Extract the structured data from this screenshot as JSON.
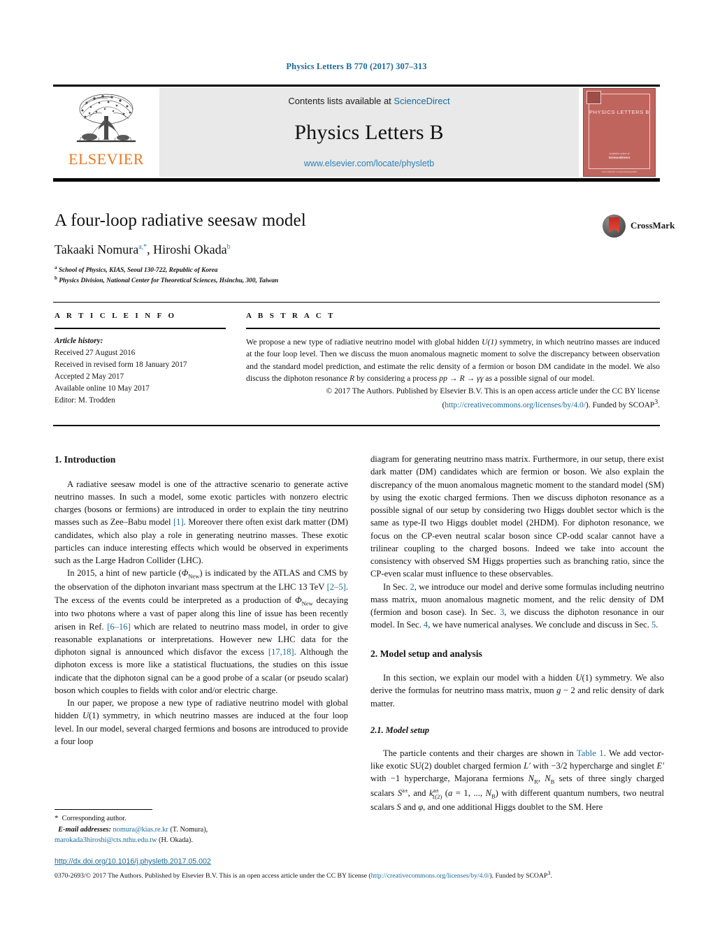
{
  "running_head": "Physics Letters B 770 (2017) 307–313",
  "masthead": {
    "contents_prefix": "Contents lists available at ",
    "contents_link": "ScienceDirect",
    "journal": "Physics Letters B",
    "url": "www.elsevier.com/locate/physletb",
    "publisher": "ELSEVIER",
    "cover": {
      "title": "PHYSICS LETTERS B",
      "foot1": "Available online at",
      "foot2": "ScienceDirect",
      "foot3": "www.elsevier.com/locate/physletb"
    }
  },
  "article": {
    "title": "A four-loop radiative seesaw model",
    "authors_part1": "Takaaki Nomura",
    "authors_sup1": "a,*",
    "authors_part2": ", Hiroshi Okada",
    "authors_sup2": "b",
    "affiliation_a": "School of Physics, KIAS, Seoul 130-722, Republic of Korea",
    "affiliation_b": "Physics Division, National Center for Theoretical Sciences, Hsinchu, 300, Taiwan",
    "crossmark_label": "CrossMark"
  },
  "info": {
    "heading": "A R T I C L E  I N F O",
    "history_label": "Article history:",
    "lines": [
      "Received 27 August 2016",
      "Received in revised form 18 January 2017",
      "Accepted 2 May 2017",
      "Available online 10 May 2017",
      "Editor: M. Trodden"
    ]
  },
  "abstract": {
    "heading": "A B S T R A C T",
    "body_1": "We propose a new type of radiative neutrino model with global hidden ",
    "body_u1": "U(1)",
    "body_2": " symmetry, in which neutrino masses are induced at the four loop level. Then we discuss the muon anomalous magnetic moment to solve the discrepancy between observation and the standard model prediction, and estimate the relic density of a fermion or boson DM candidate in the model. We also discuss the diphoton resonance ",
    "body_R": "R",
    "body_3": " by considering a process ",
    "body_proc": "pp → R → γγ",
    "body_4": " as a possible signal of our model.",
    "copyright_1": "© 2017 The Authors. Published by Elsevier B.V. This is an open access article under the CC BY license (",
    "copyright_link": "http://creativecommons.org/licenses/by/4.0/",
    "copyright_2": "). Funded by SCOAP",
    "copyright_sup": "3",
    "copyright_3": "."
  },
  "body": {
    "sec1_heading": "1. Introduction",
    "sec1_p1": "A radiative seesaw model is one of the attractive scenario to generate active neutrino masses. In such a model, some exotic particles with nonzero electric charges (bosons or fermions) are introduced in order to explain the tiny neutrino masses such as Zee–Babu model [1]. Moreover there often exist dark matter (DM) candidates, which also play a role in generating neutrino masses. These exotic particles can induce interesting effects which would be observed in experiments such as the Large Hadron Collider (LHC).",
    "sec1_p2": "In 2015, a hint of new particle (ΦNew) is indicated by the ATLAS and CMS by the observation of the diphoton invariant mass spectrum at the LHC 13 TeV [2–5]. The excess of the events could be interpreted as a production of ΦNew decaying into two photons where a vast of paper along this line of issue has been recently arisen in Ref. [6–16] which are related to neutrino mass model, in order to give reasonable explanations or interpretations. However new LHC data for the diphoton signal is announced which disfavor the excess [17,18]. Although the diphoton excess is more like a statistical fluctuations, the studies on this issue indicate that the diphoton signal can be a good probe of a scalar (or pseudo scalar) boson which couples to fields with color and/or electric charge.",
    "sec1_p3": "In our paper, we propose a new type of radiative neutrino model with global hidden U(1) symmetry, in which neutrino masses are induced at the four loop level. In our model, several charged fermions and bosons are introduced to provide a four loop",
    "sec1_p4": "diagram for generating neutrino mass matrix. Furthermore, in our setup, there exist dark matter (DM) candidates which are fermion or boson. We also explain the discrepancy of the muon anomalous magnetic moment to the standard model (SM) by using the exotic charged fermions. Then we discuss diphoton resonance as a possible signal of our setup by considering two Higgs doublet sector which is the same as type-II two Higgs doublet model (2HDM). For diphoton resonance, we focus on the CP-even neutral scalar boson since CP-odd scalar cannot have a trilinear coupling to the charged bosons. Indeed we take into account the consistency with observed SM Higgs properties such as branching ratio, since the CP-even scalar must influence to these observables.",
    "sec1_p5": "In Sec. 2, we introduce our model and derive some formulas including neutrino mass matrix, muon anomalous magnetic moment, and the relic density of DM (fermion and boson case). In Sec. 3, we discuss the diphoton resonance in our model. In Sec. 4, we have numerical analyses. We conclude and discuss in Sec. 5.",
    "sec2_heading": "2. Model setup and analysis",
    "sec2_p1": "In this section, we explain our model with a hidden U(1) symmetry. We also derive the formulas for neutrino mass matrix, muon g − 2 and relic density of dark matter.",
    "sec21_heading": "2.1. Model setup",
    "sec21_p1": "The particle contents and their charges are shown in Table 1. We add vector-like exotic SU(2) doublet charged fermion L′ with −3/2 hypercharge and singlet E′ with −1 hypercharge, Majorana fermions NR, NB sets of three singly charged scalars Sa±, and k1(2)a± (a = 1, ..., NB) with different quantum numbers, two neutral scalars S and φ, and one additional Higgs doublet to the SM. Here",
    "links": {
      "ref1": "[1]",
      "ref25": "[2–5]",
      "ref616": "[6–16]",
      "ref1718": "[17,18]",
      "sec2": "2",
      "sec3": "3",
      "sec4": "4",
      "sec5": "5",
      "table1": "Table 1"
    }
  },
  "footer": {
    "corresponding": "Corresponding author.",
    "email_label": "E-mail addresses:",
    "email1": "nomura@kias.re.kr",
    "email1_owner": "(T. Nomura),",
    "email2": "marokada3hiroshi@cts.nthu.edu.tw",
    "email2_owner": "(H. Okada).",
    "doi": "http://dx.doi.org/10.1016/j.physletb.2017.05.002",
    "copyright_1": "0370-2693/© 2017 The Authors. Published by Elsevier B.V. This is an open access article under the CC BY license (",
    "copyright_link": "http://creativecommons.org/licenses/by/4.0/",
    "copyright_2": "). Funded by SCOAP",
    "copyright_sup": "3",
    "copyright_3": "."
  },
  "colors": {
    "link": "#1a6a9a",
    "elsevier_orange": "#E87722",
    "cover_red": "#c0655e",
    "banner_gray": "#e9e9e9"
  }
}
